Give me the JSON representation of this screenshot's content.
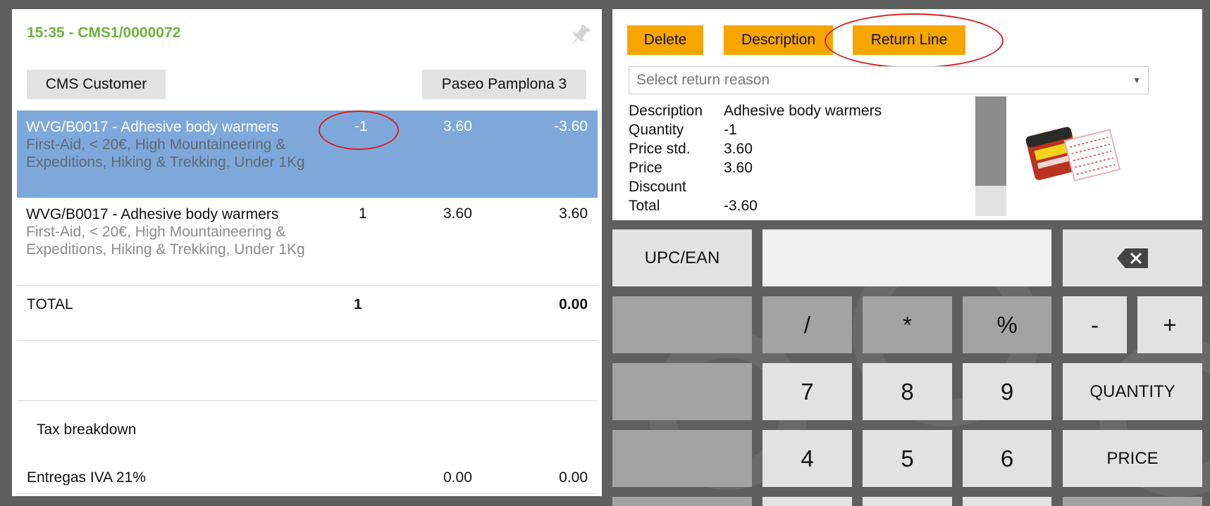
{
  "receipt": {
    "header": "15:35 - CMS1/0000072",
    "customer_button": "CMS Customer",
    "address_button": "Paseo Pamplona 3",
    "lines": [
      {
        "description": "WVG/B0017 - Adhesive body warmers",
        "categories": "First-Aid, < 20€, High Mountaineering & Expeditions, Hiking & Trekking, Under 1Kg",
        "qty": "-1",
        "price": "3.60",
        "total": "-3.60",
        "selected": true
      },
      {
        "description": "WVG/B0017 - Adhesive body warmers",
        "categories": "First-Aid, < 20€, High Mountaineering & Expeditions, Hiking & Trekking, Under 1Kg",
        "qty": "1",
        "price": "3.60",
        "total": "3.60",
        "selected": false
      }
    ],
    "total_label": "TOTAL",
    "total_qty": "1",
    "total_amount": "0.00",
    "tax_breakdown_label": "Tax breakdown",
    "tax_line": {
      "label": "Entregas IVA 21%",
      "base": "0.00",
      "amount": "0.00"
    }
  },
  "edit_panel": {
    "buttons": {
      "delete": "Delete",
      "description": "Description",
      "return_line": "Return Line"
    },
    "return_reason_placeholder": "Select return reason",
    "details": [
      {
        "label": "Description",
        "value": "Adhesive body warmers"
      },
      {
        "label": "Quantity",
        "value": "-1"
      },
      {
        "label": "Price std.",
        "value": "3.60"
      },
      {
        "label": "Price",
        "value": "3.60"
      },
      {
        "label": "Discount",
        "value": ""
      },
      {
        "label": "Total",
        "value": "-3.60"
      }
    ],
    "product_image_icon": "product-package-icon"
  },
  "keypad": {
    "upc_label": "UPC/EAN",
    "input_value": "",
    "backspace_icon": "backspace-icon",
    "keys_ops": [
      "/",
      "*",
      "%",
      "-",
      "+"
    ],
    "keys_row1": [
      "7",
      "8",
      "9"
    ],
    "quantity_label": "QUANTITY",
    "keys_row2": [
      "4",
      "5",
      "6"
    ],
    "price_label": "PRICE"
  },
  "colors": {
    "header_green": "#6cb33f",
    "selected_row_blue": "#7ea8da",
    "action_orange": "#f7a600",
    "annotation_red": "#d92020",
    "background_gray": "#5f5f5f"
  }
}
